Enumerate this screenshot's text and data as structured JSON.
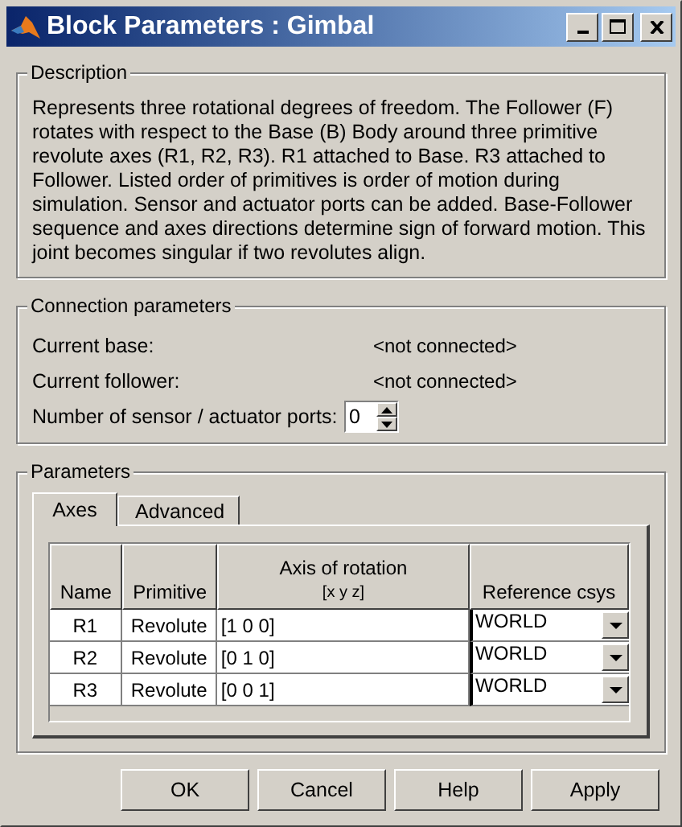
{
  "window": {
    "title": "Block Parameters : Gimbal"
  },
  "description": {
    "title": "Description",
    "text": "Represents three rotational degrees of freedom. The Follower (F) rotates with respect to the Base (B) Body around three primitive revolute axes (R1, R2, R3). R1 attached to Base. R3 attached to Follower. Listed order of primitives is order of motion during simulation. Sensor and actuator ports can be added. Base-Follower sequence and axes directions determine sign of forward motion. This joint becomes singular if two revolutes align."
  },
  "connection": {
    "title": "Connection parameters",
    "rows": [
      {
        "label": "Current base:",
        "value": "<not connected>"
      },
      {
        "label": "Current follower:",
        "value": "<not connected>"
      }
    ],
    "ports": {
      "label": "Number of sensor / actuator ports:",
      "value": "0"
    }
  },
  "parameters": {
    "title": "Parameters",
    "tabs": [
      {
        "label": "Axes",
        "selected": true
      },
      {
        "label": "Advanced",
        "selected": false
      }
    ],
    "table": {
      "columns": [
        {
          "label": "Name"
        },
        {
          "label": "Primitive"
        },
        {
          "label": "Axis of rotation",
          "sublabel": "[x y z]"
        },
        {
          "label": "Reference csys"
        }
      ],
      "rows": [
        {
          "name": "R1",
          "primitive": "Revolute",
          "axis": "[1 0 0]",
          "reference": "WORLD"
        },
        {
          "name": "R2",
          "primitive": "Revolute",
          "axis": "[0 1 0]",
          "reference": "WORLD"
        },
        {
          "name": "R3",
          "primitive": "Revolute",
          "axis": "[0 0 1]",
          "reference": "WORLD"
        }
      ]
    }
  },
  "buttons": [
    "OK",
    "Cancel",
    "Help",
    "Apply"
  ]
}
